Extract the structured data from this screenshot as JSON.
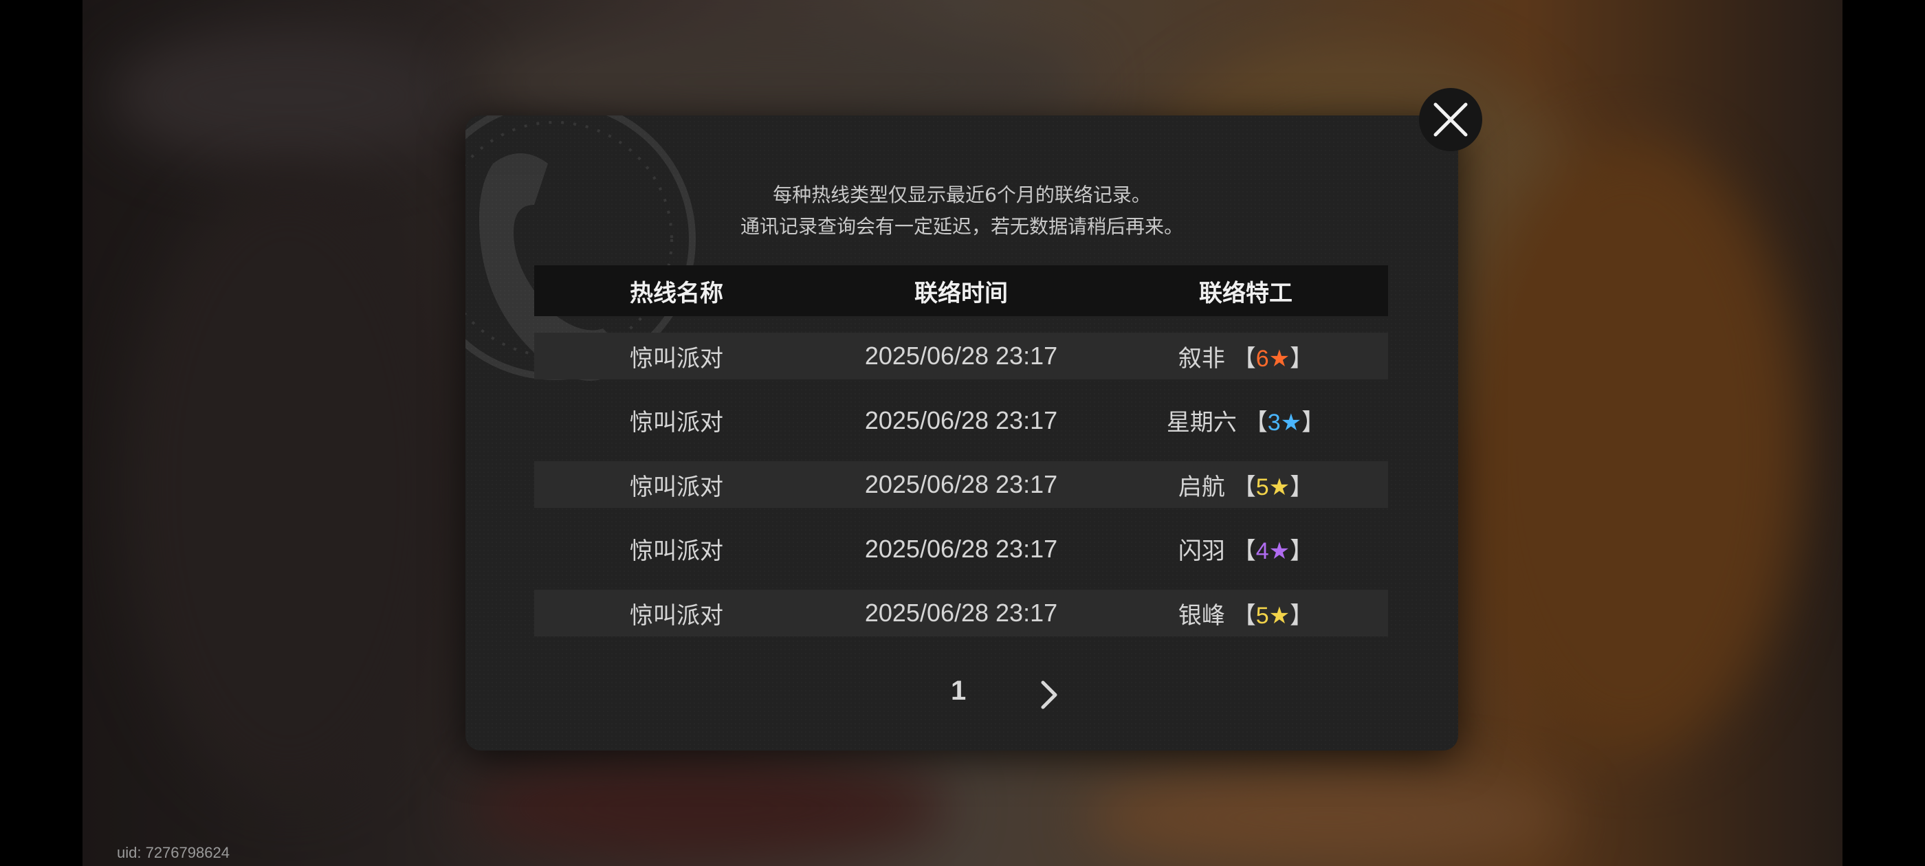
{
  "uid_text": "uid: 7276798624",
  "notice": {
    "line1": "每种热线类型仅显示最近6个月的联络记录。",
    "line2": "通讯记录查询会有一定延迟，若无数据请稍后再来。"
  },
  "table": {
    "headers": [
      "热线名称",
      "联络时间",
      "联络特工"
    ],
    "rows": [
      {
        "hotline": "惊叫派对",
        "time": "2025/06/28 23:17",
        "agent": "叙非",
        "rank": "6",
        "star_color": "#ff6a2b"
      },
      {
        "hotline": "惊叫派对",
        "time": "2025/06/28 23:17",
        "agent": "星期六",
        "rank": "3",
        "star_color": "#4ab6ff"
      },
      {
        "hotline": "惊叫派对",
        "time": "2025/06/28 23:17",
        "agent": "启航",
        "rank": "5",
        "star_color": "#f2d34a"
      },
      {
        "hotline": "惊叫派对",
        "time": "2025/06/28 23:17",
        "agent": "闪羽",
        "rank": "4",
        "star_color": "#b06cf0"
      },
      {
        "hotline": "惊叫派对",
        "time": "2025/06/28 23:17",
        "agent": "银峰",
        "rank": "5",
        "star_color": "#f2d34a"
      }
    ]
  },
  "pager": {
    "current_page": "1"
  },
  "icons": {
    "close": "close-icon",
    "next": "chevron-right-icon",
    "watermark": "phone-icon",
    "star": "star-icon"
  }
}
